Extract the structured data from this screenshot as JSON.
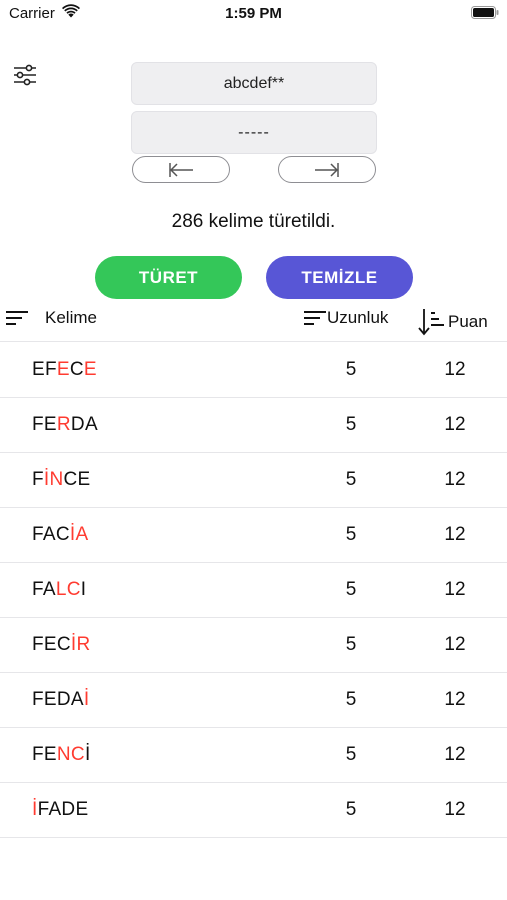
{
  "status_bar": {
    "carrier": "Carrier",
    "time": "1:59 PM"
  },
  "inputs": {
    "letters": "abcdef**",
    "pattern": "-----"
  },
  "result_text": "286 kelime türetildi.",
  "buttons": {
    "turet": "TÜRET",
    "temizle": "TEMİZLE"
  },
  "table": {
    "headers": {
      "word": "Kelime",
      "length": "Uzunluk",
      "points": "Puan"
    },
    "rows": [
      {
        "parts": [
          [
            "EF",
            false
          ],
          [
            "E",
            true
          ],
          [
            "C",
            false
          ],
          [
            "E",
            true
          ]
        ],
        "length": "5",
        "points": "12"
      },
      {
        "parts": [
          [
            "FE",
            false
          ],
          [
            "R",
            true
          ],
          [
            "DA",
            false
          ]
        ],
        "length": "5",
        "points": "12"
      },
      {
        "parts": [
          [
            "F",
            false
          ],
          [
            "İN",
            true
          ],
          [
            "CE",
            false
          ]
        ],
        "length": "5",
        "points": "12"
      },
      {
        "parts": [
          [
            "FAC",
            false
          ],
          [
            "İA",
            true
          ]
        ],
        "length": "5",
        "points": "12"
      },
      {
        "parts": [
          [
            "FA",
            false
          ],
          [
            "LC",
            true
          ],
          [
            "I",
            false
          ]
        ],
        "length": "5",
        "points": "12"
      },
      {
        "parts": [
          [
            "FEC",
            false
          ],
          [
            "İR",
            true
          ]
        ],
        "length": "5",
        "points": "12"
      },
      {
        "parts": [
          [
            "FEDA",
            false
          ],
          [
            "İ",
            true
          ]
        ],
        "length": "5",
        "points": "12"
      },
      {
        "parts": [
          [
            "FE",
            false
          ],
          [
            "NC",
            true
          ],
          [
            "İ",
            false
          ]
        ],
        "length": "5",
        "points": "12"
      },
      {
        "parts": [
          [
            "İ",
            true
          ],
          [
            "FADE",
            false
          ]
        ],
        "length": "5",
        "points": "12"
      }
    ]
  },
  "colors": {
    "green": "#34c759",
    "purple": "#5856d6",
    "highlight": "#ff3b30"
  }
}
